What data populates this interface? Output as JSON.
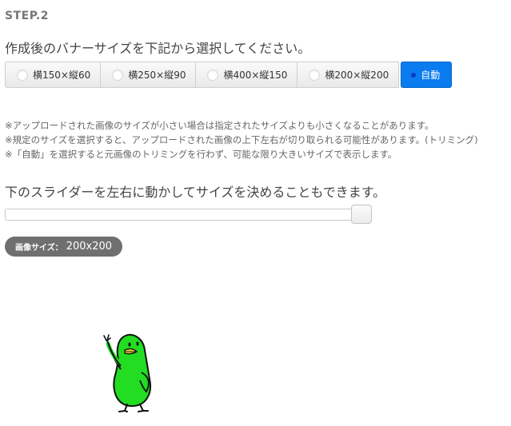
{
  "step": {
    "title": "STEP.2"
  },
  "instruction": "作成後のバナーサイズを下記から選択してください。",
  "size_options": [
    {
      "label": "横150×縦60",
      "selected": false
    },
    {
      "label": "横250×縦90",
      "selected": false
    },
    {
      "label": "横400×縦150",
      "selected": false
    },
    {
      "label": "横200×縦200",
      "selected": false
    },
    {
      "label": "自動",
      "selected": true
    }
  ],
  "notes": [
    "※アップロードされた画像のサイズが小さい場合は指定されたサイズよりも小さくなることがあります。",
    "※規定のサイズを選択すると、アップロードされた画像の上下左右が切り取られる可能性があります。(トリミング)",
    "※「自動」を選択すると元画像のトリミングを行わず、可能な限り大きいサイズで表示します。"
  ],
  "slider": {
    "caption": "下のスライダーを左右に動かしてサイズを決めることもできます。",
    "value_fraction": 0.97
  },
  "size_badge": {
    "label": "画像サイズ：",
    "value": "200x200"
  },
  "colors": {
    "accent": "#0a7cf0",
    "badge": "#6f6f6f",
    "mascot": "#22dd22"
  },
  "mascot": {
    "icon": "green-bird-mascot-icon"
  }
}
